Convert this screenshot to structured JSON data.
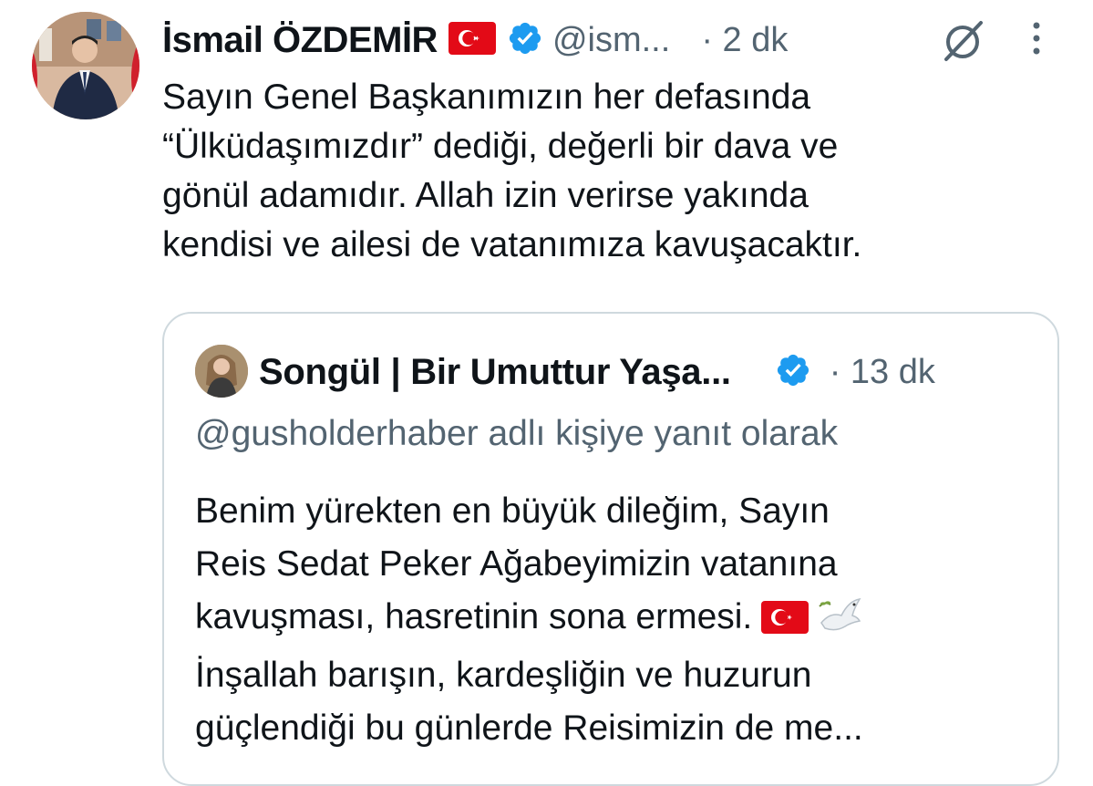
{
  "tweet": {
    "author_name": "İsmail ÖZDEMİR",
    "handle": "@ism...",
    "time": "· 2 dk",
    "flag_icon": "turkey-flag-icon",
    "verified_icon": "verified-badge-icon",
    "lines": [
      "Sayın Genel Başkanımızın her defasında",
      "“Ülküdaşımızdır” dediği, değerli bir dava ve",
      "gönül adamıdır. Allah izin verirse yakında",
      "kendisi ve ailesi de vatanımıza kavuşacaktır."
    ]
  },
  "quote": {
    "author_name": "Songül | Bir Umuttur Yaşa...",
    "time": "· 13 dk",
    "reply_context": "@gusholderhaber adlı kişiye yanıt olarak",
    "lines": [
      "Benim yürekten en büyük dileğim, Sayın",
      "Reis Sedat Peker Ağabeyimizin vatanına",
      "kavuşması, hasretinin sona ermesi.",
      "İnşallah barışın, kardeşliğin ve huzurun",
      "güçlendiği bu günlerde Reisimizin de me..."
    ],
    "line3_emojis": [
      "turkey-flag-icon",
      "dove-icon"
    ]
  },
  "colors": {
    "text": "#0f1419",
    "secondary": "#536471",
    "verified_blue": "#1d9bf0",
    "flag_red": "#e30a17",
    "border": "#cfd9de"
  }
}
